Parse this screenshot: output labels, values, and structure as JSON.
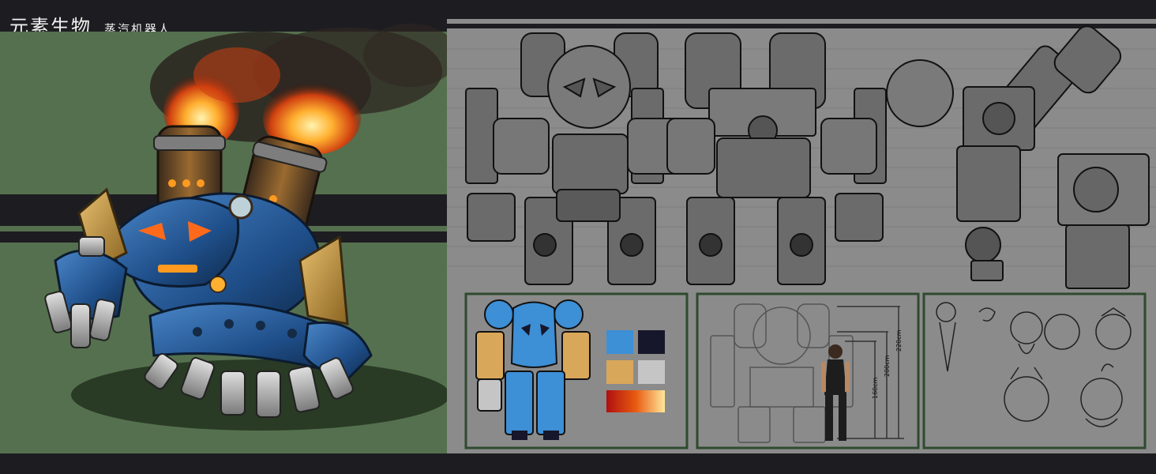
{
  "title": {
    "main": "元素生物",
    "separator": "_",
    "subtitle": "蒸汽机器人"
  },
  "height_labels": {
    "robot": "220cm",
    "mid": "200cm",
    "human": "160cm"
  },
  "palette": [
    "#3d8fd6",
    "#16172a",
    "#d9a75a",
    "#c5c5c5"
  ],
  "gradient": [
    "#b01010",
    "#e85a10",
    "#ffe89a"
  ],
  "colors": {
    "left_bg": "#55704e",
    "sheet_bg": "#8b8b8b",
    "frame": "#2f4a2f"
  }
}
